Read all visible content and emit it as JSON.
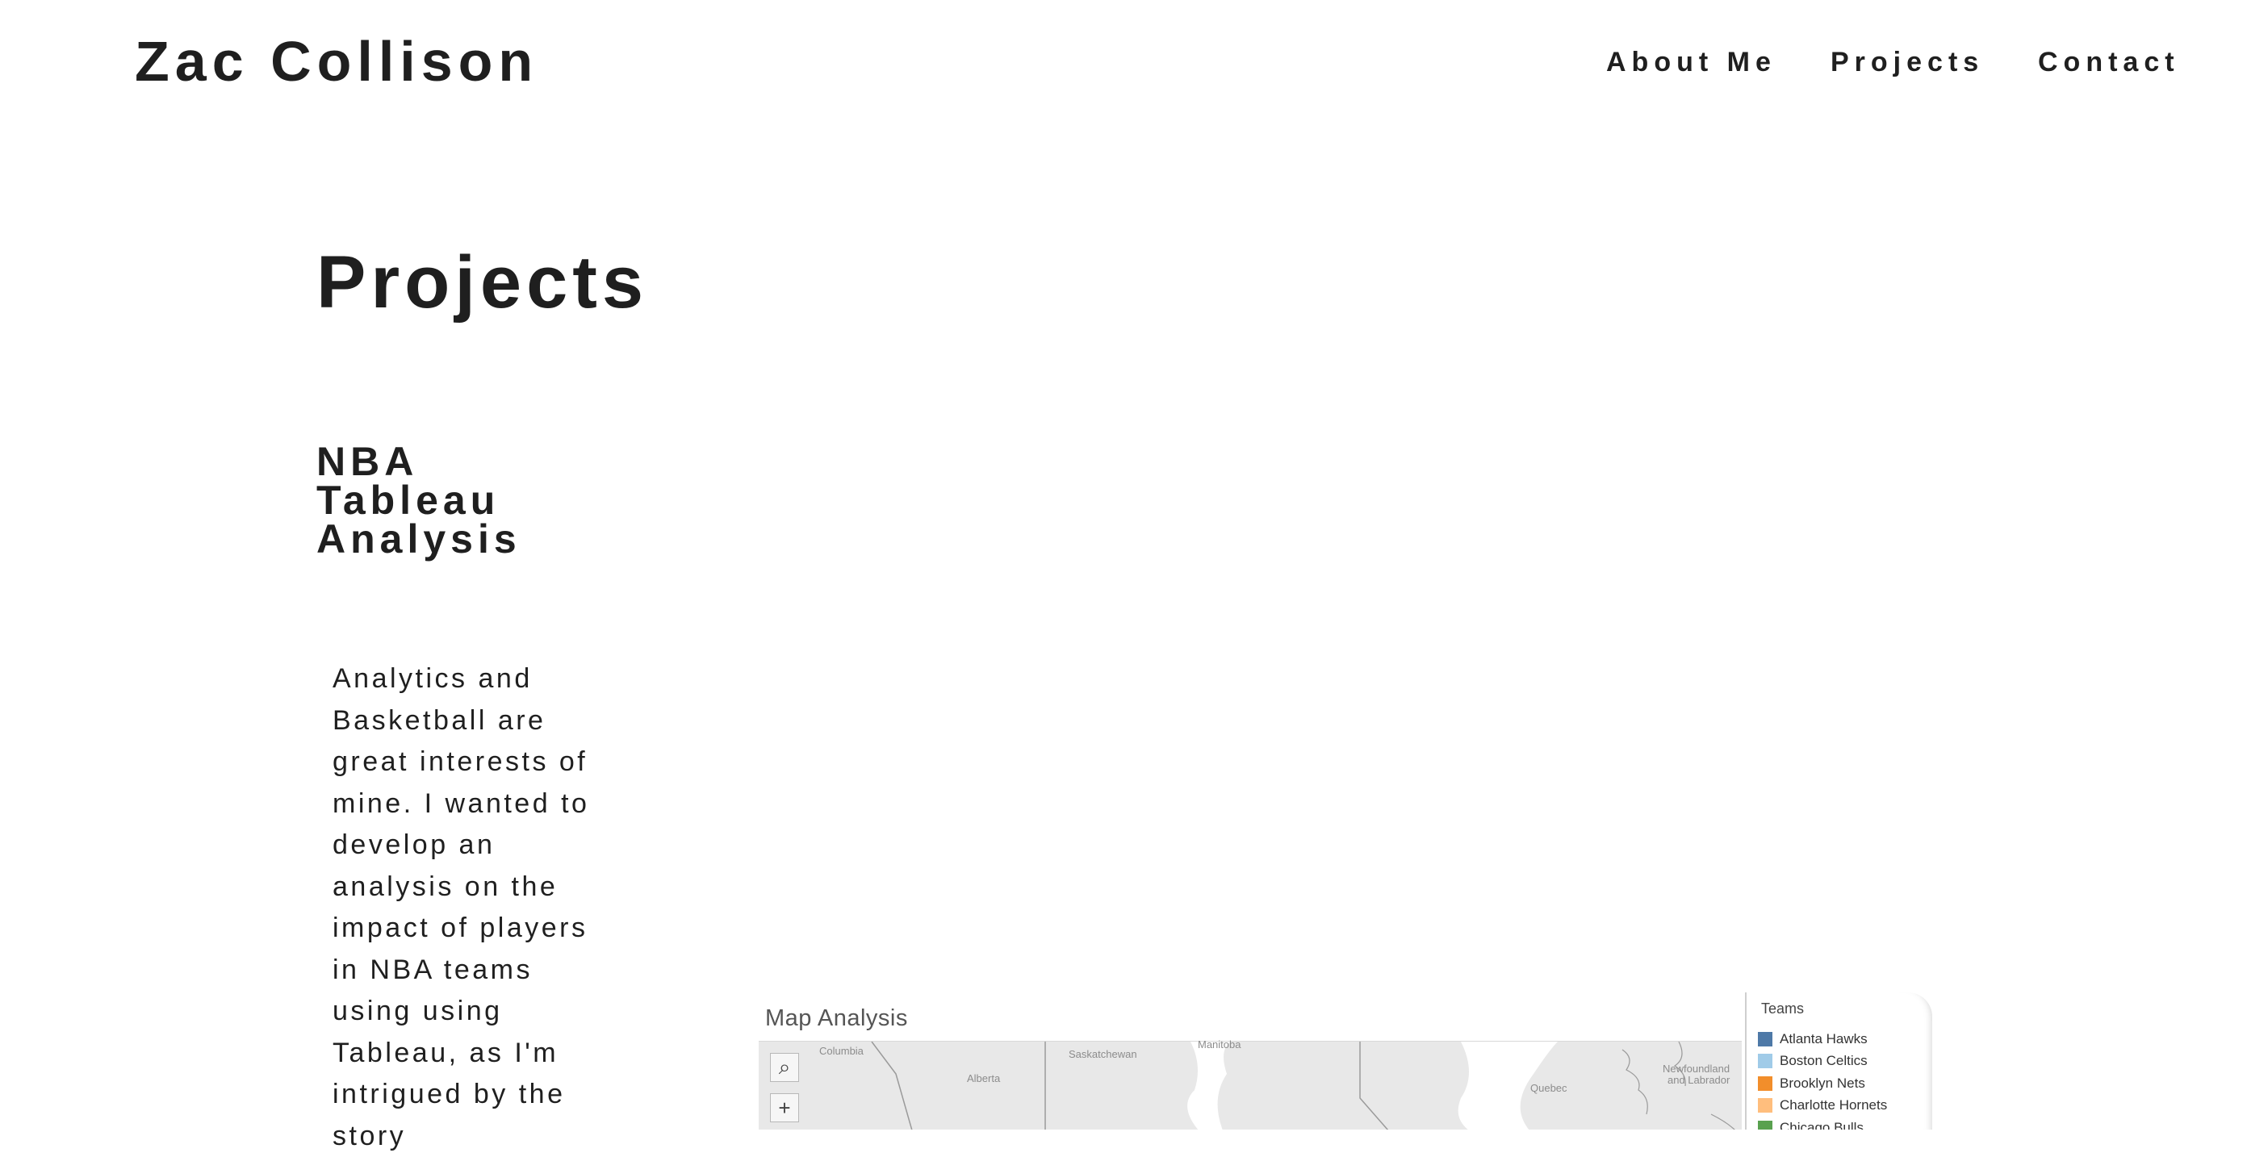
{
  "header": {
    "site_title": "Zac Collison",
    "nav": [
      {
        "label": "About Me"
      },
      {
        "label": "Projects"
      },
      {
        "label": "Contact"
      }
    ]
  },
  "page": {
    "title": "Projects"
  },
  "project": {
    "title": "NBA Tableau Analysis",
    "description": "Analytics and Basketball are great interests of mine. I wanted to develop an analysis on the impact of players in NBA teams using using Tableau, as I'm intrigued by the story"
  },
  "viz": {
    "title": "Map Analysis",
    "map_labels": [
      "Columbia",
      "Alberta",
      "Saskatchewan",
      "Manitoba",
      "Quebec",
      "Newfoundland",
      "and Labrador"
    ],
    "controls": [
      {
        "icon": "search-icon",
        "glyph": "⌕"
      },
      {
        "icon": "zoom-in-icon",
        "glyph": "+"
      }
    ],
    "legend": {
      "title": "Teams",
      "items": [
        {
          "label": "Atlanta Hawks",
          "color": "#4e79a7"
        },
        {
          "label": "Boston Celtics",
          "color": "#a0cbe8"
        },
        {
          "label": "Brooklyn Nets",
          "color": "#f28e2b"
        },
        {
          "label": "Charlotte Hornets",
          "color": "#ffbe7d"
        },
        {
          "label": "Chicago Bulls",
          "color": "#59a14f"
        }
      ]
    }
  }
}
